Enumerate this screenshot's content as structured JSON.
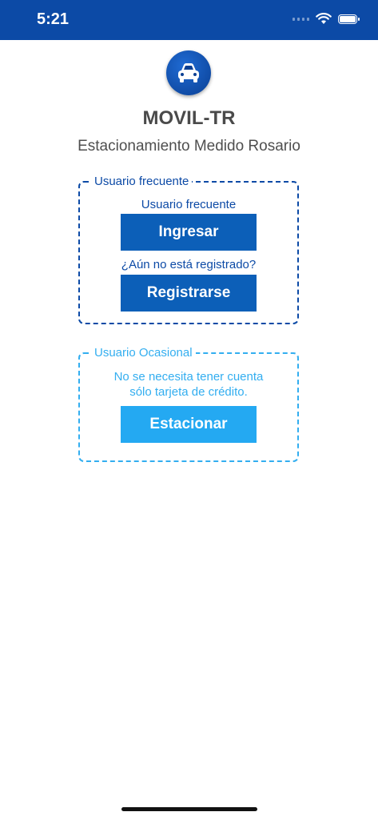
{
  "status_bar": {
    "time": "5:21"
  },
  "app": {
    "title": "MOVIL-TR",
    "subtitle": "Estacionamiento Medido Rosario"
  },
  "frequent_user": {
    "legend": "Usuario frecuente",
    "caption": "Usuario frecuente",
    "login_button": "Ingresar",
    "register_question": "¿Aún no está registrado?",
    "register_button": "Registrarse"
  },
  "occasional_user": {
    "legend": "Usuario Ocasional",
    "caption_line1": "No se necesita tener cuenta",
    "caption_line2": "sólo tarjeta de crédito.",
    "park_button": "Estacionar"
  },
  "colors": {
    "primary_dark": "#0c4aa6",
    "button_dark": "#0c5fb8",
    "accent_light": "#33aef0",
    "button_light": "#24a9f2"
  },
  "icons": [
    "car-icon",
    "signal-icon",
    "wifi-icon",
    "battery-icon"
  ]
}
